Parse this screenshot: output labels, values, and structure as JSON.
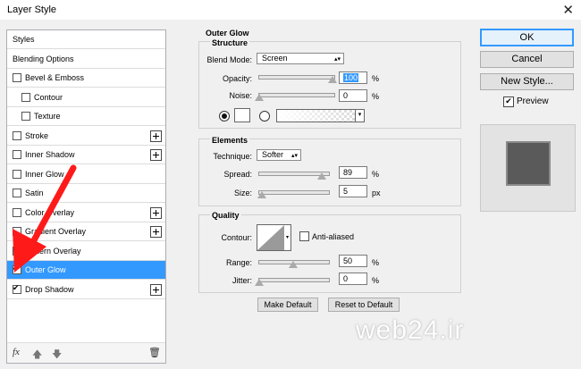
{
  "window": {
    "title": "Layer Style",
    "close_icon": "close-icon"
  },
  "sidebar": {
    "items": [
      {
        "label": "Styles",
        "checkbox": false,
        "checked": false,
        "plus": false,
        "indent": 0
      },
      {
        "label": "Blending Options",
        "checkbox": false,
        "checked": false,
        "plus": false,
        "indent": 0
      },
      {
        "label": "Bevel & Emboss",
        "checkbox": true,
        "checked": false,
        "plus": false,
        "indent": 0
      },
      {
        "label": "Contour",
        "checkbox": true,
        "checked": false,
        "plus": false,
        "indent": 1
      },
      {
        "label": "Texture",
        "checkbox": true,
        "checked": false,
        "plus": false,
        "indent": 1
      },
      {
        "label": "Stroke",
        "checkbox": true,
        "checked": false,
        "plus": true,
        "indent": 0
      },
      {
        "label": "Inner Shadow",
        "checkbox": true,
        "checked": false,
        "plus": true,
        "indent": 0
      },
      {
        "label": "Inner Glow",
        "checkbox": true,
        "checked": false,
        "plus": false,
        "indent": 0
      },
      {
        "label": "Satin",
        "checkbox": true,
        "checked": false,
        "plus": false,
        "indent": 0
      },
      {
        "label": "Color Overlay",
        "checkbox": true,
        "checked": false,
        "plus": true,
        "indent": 0
      },
      {
        "label": "Gradient Overlay",
        "checkbox": true,
        "checked": false,
        "plus": true,
        "indent": 0
      },
      {
        "label": "Pattern Overlay",
        "checkbox": true,
        "checked": false,
        "plus": false,
        "indent": 0
      },
      {
        "label": "Outer Glow",
        "checkbox": true,
        "checked": true,
        "plus": false,
        "indent": 0,
        "selected": true
      },
      {
        "label": "Drop Shadow",
        "checkbox": true,
        "checked": true,
        "plus": true,
        "indent": 0
      }
    ],
    "footer": {
      "fx": "fx",
      "up_icon": "arrow-up-icon",
      "down_icon": "arrow-down-icon",
      "trash_icon": "trash-icon"
    }
  },
  "panel": {
    "header": "Outer Glow",
    "structure": {
      "title": "Structure",
      "blend_mode_label": "Blend Mode:",
      "blend_mode": "Screen",
      "opacity_label": "Opacity:",
      "opacity": "100",
      "opacity_unit": "%",
      "noise_label": "Noise:",
      "noise": "0",
      "noise_unit": "%"
    },
    "elements": {
      "title": "Elements",
      "technique_label": "Technique:",
      "technique": "Softer",
      "spread_label": "Spread:",
      "spread": "89",
      "spread_unit": "%",
      "size_label": "Size:",
      "size": "5",
      "size_unit": "px"
    },
    "quality": {
      "title": "Quality",
      "contour_label": "Contour:",
      "anti_aliased_label": "Anti-aliased",
      "range_label": "Range:",
      "range": "50",
      "range_unit": "%",
      "jitter_label": "Jitter:",
      "jitter": "0",
      "jitter_unit": "%"
    },
    "make_default": "Make Default",
    "reset_default": "Reset to Default"
  },
  "right": {
    "ok": "OK",
    "cancel": "Cancel",
    "new_style": "New Style...",
    "preview_label": "Preview",
    "preview_checked": true
  },
  "watermark": "web24.ir",
  "colors": {
    "selection": "#3399ff",
    "annotation_arrow": "#ff1a1a"
  }
}
